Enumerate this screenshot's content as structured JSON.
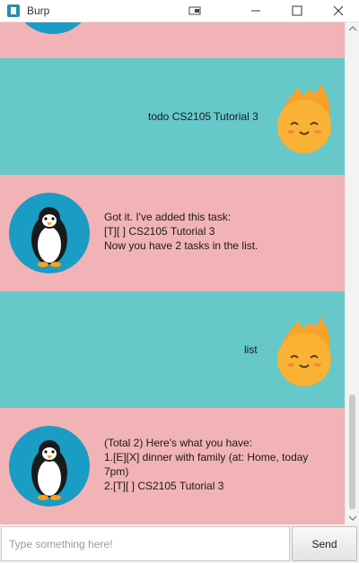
{
  "window": {
    "title": "Burp"
  },
  "chat": {
    "messages": [
      {
        "role": "user",
        "lines": [
          "todo CS2105 Tutorial 3"
        ]
      },
      {
        "role": "bot",
        "lines": [
          "Got it. I've added this task:",
          "[T][ ] CS2105 Tutorial 3",
          "Now you have 2 tasks in the list."
        ]
      },
      {
        "role": "user",
        "lines": [
          "list"
        ]
      },
      {
        "role": "bot",
        "lines": [
          "(Total 2) Here's what you have:",
          "1.[E][X] dinner with family (at: Home, today",
          "7pm)",
          "2.[T][ ] CS2105 Tutorial 3"
        ]
      }
    ]
  },
  "input": {
    "placeholder": "Type something here!",
    "value": ""
  },
  "send_button": {
    "label": "Send"
  },
  "colors": {
    "bot_bg": "#f2b3b7",
    "user_bg": "#66c8c8",
    "avatar_ring": "#1a9cc4"
  }
}
